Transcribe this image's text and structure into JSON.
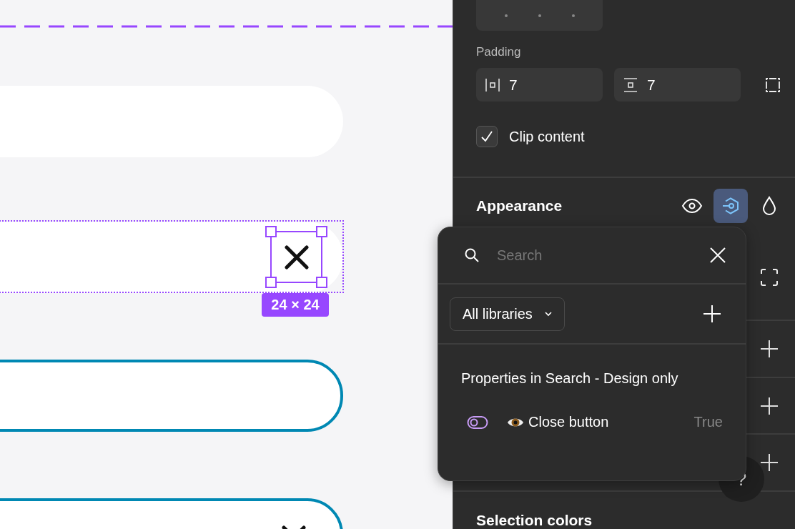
{
  "canvas": {
    "shapes": [
      {
        "kind": "plain"
      },
      {
        "kind": "selected",
        "size_label": "24 × 24"
      },
      {
        "kind": "outlined"
      },
      {
        "kind": "outlined_close"
      }
    ]
  },
  "panel": {
    "padding": {
      "label": "Padding",
      "horizontal": "7",
      "vertical": "7"
    },
    "clip_content": {
      "label": "Clip content",
      "checked": true
    },
    "appearance": {
      "title": "Appearance",
      "tools": [
        {
          "kind": "visibility",
          "selected": false
        },
        {
          "kind": "variable",
          "selected": true
        },
        {
          "kind": "opacity",
          "selected": false
        }
      ]
    },
    "help_button": "?",
    "next_section": "Selection colors"
  },
  "popover": {
    "search": {
      "placeholder": "Search"
    },
    "library_filter": "All libraries",
    "heading": "Properties in Search - Design only",
    "properties": [
      {
        "kind": "boolean",
        "name": "Close button",
        "value": "True"
      }
    ]
  }
}
